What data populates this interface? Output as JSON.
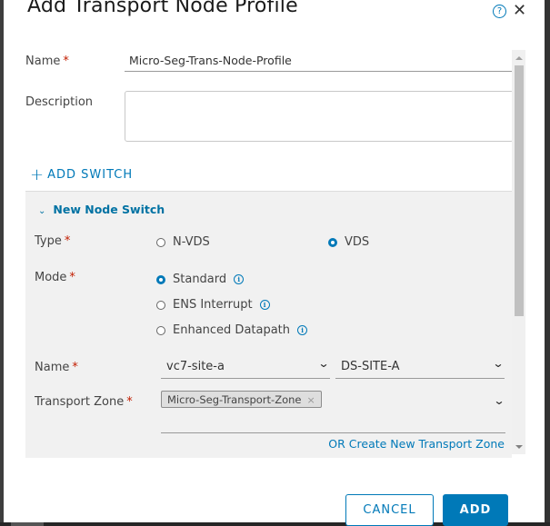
{
  "dialog": {
    "title": "Add Transport Node Profile",
    "help_icon": "?",
    "close_icon": "✕"
  },
  "form": {
    "name_label": "Name",
    "name_value": "Micro-Seg-Trans-Node-Profile",
    "description_label": "Description",
    "description_value": "",
    "required_mark": "*",
    "add_switch_plus": "+",
    "add_switch_label": "ADD SWITCH"
  },
  "switch_panel": {
    "header_chevron": "⌄",
    "header": "New Node Switch",
    "type_label": "Type",
    "type_options": [
      {
        "label": "N-VDS",
        "selected": false
      },
      {
        "label": "VDS",
        "selected": true
      }
    ],
    "mode_label": "Mode",
    "mode_options": [
      {
        "label": "Standard",
        "selected": true
      },
      {
        "label": "ENS Interrupt",
        "selected": false
      },
      {
        "label": "Enhanced Datapath",
        "selected": false
      }
    ],
    "info_icon": "i",
    "name_label": "Name",
    "vcenter_value": "vc7-site-a",
    "vds_value": "DS-SITE-A",
    "select_chevron": "⌄",
    "transport_zone_label": "Transport Zone",
    "transport_zone_chips": [
      "Micro-Seg-Transport-Zone"
    ],
    "chip_remove": "×",
    "create_tz_link": "OR Create New Transport Zone"
  },
  "footer": {
    "cancel_label": "CANCEL",
    "add_label": "ADD"
  },
  "colors": {
    "accent": "#0079b8",
    "required": "#c21d00",
    "panel_bg": "#f1f1f1"
  }
}
